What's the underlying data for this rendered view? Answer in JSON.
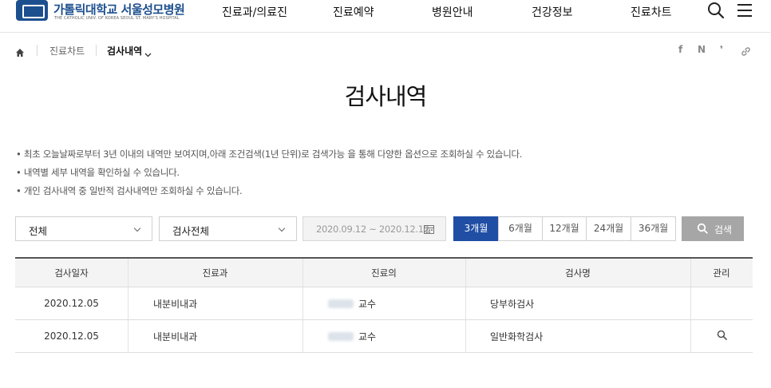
{
  "header": {
    "logo_title": "가톨릭대학교 서울성모병원",
    "logo_subtitle": "THE CATHOLIC UNIV. OF KOREA SEOUL ST. MARY'S HOSPITAL",
    "nav": [
      "진료과/의료진",
      "진료예약",
      "병원안내",
      "건강정보",
      "진료차트"
    ],
    "icons": [
      "search-icon",
      "menu-icon"
    ]
  },
  "breadcrumb": {
    "home_icon": "home-icon",
    "level1": "진료차트",
    "level2": "검사내역"
  },
  "share_icons": [
    "facebook-icon",
    "naver-icon",
    "kakao-story-icon",
    "link-icon"
  ],
  "page_title": "검사내역",
  "notices": [
    "최초 오늘날짜로부터 3년 이내의 내역만 보여지며,아래 조건검색(1년 단위)로 검색가능 을 통해 다양한 옵션으로 조회하실 수 있습니다.",
    "내역별 세부 내역을 확인하실 수 있습니다.",
    "개인 검사내역 중 일반적 검사내역만 조회하실 수 있습니다."
  ],
  "filters": {
    "department_select": "전체",
    "exam_select": "검사전체",
    "date_range": "2020.09.12 ~ 2020.12.12",
    "periods": [
      "3개월",
      "6개월",
      "12개월",
      "24개월",
      "36개월"
    ],
    "active_period": "3개월",
    "search_label": "검색"
  },
  "table": {
    "headers": [
      "검사일자",
      "진료과",
      "진료의",
      "검사명",
      "관리"
    ],
    "rows": [
      {
        "date": "2020.12.05",
        "dept": "내분비내과",
        "doctor_title": "교수",
        "exam": "당부하검사",
        "manage": ""
      },
      {
        "date": "2020.12.05",
        "dept": "내분비내과",
        "doctor_title": "교수",
        "exam": "일반화학검사",
        "manage": "search-icon"
      }
    ]
  },
  "colors": {
    "brand": "#1c4f8e",
    "active_period": "#1f4ea4",
    "search_button": "#a6a6a6"
  }
}
